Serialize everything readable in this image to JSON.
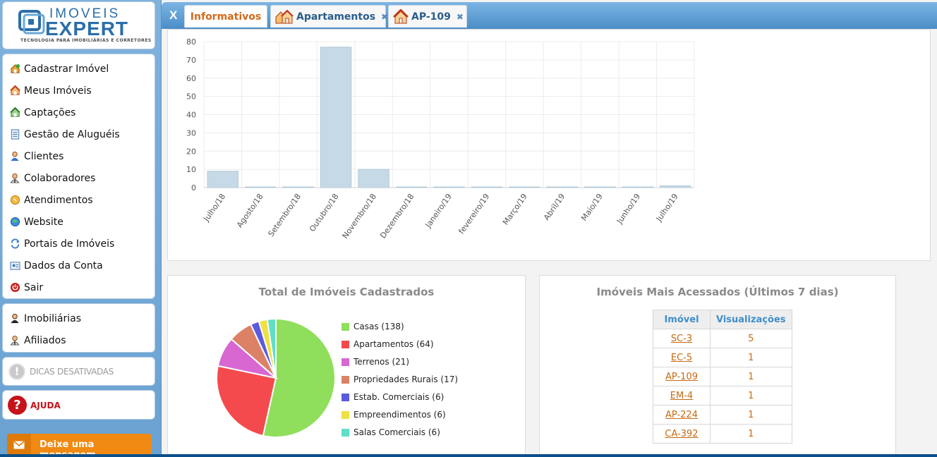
{
  "brand": {
    "title_line1": "IMOVEIS",
    "title_line2": "EXPERT",
    "tagline": "TECNOLOGIA PARA IMOBILIÁRIAS E CORRETORES"
  },
  "sidebar": {
    "menu": [
      {
        "label": "Cadastrar Imóvel",
        "icon": "house-add-icon"
      },
      {
        "label": "Meus Imóveis",
        "icon": "house-icon"
      },
      {
        "label": "Captações",
        "icon": "house-green-icon"
      },
      {
        "label": "Gestão de Aluguéis",
        "icon": "document-icon"
      },
      {
        "label": "Clientes",
        "icon": "user-icon"
      },
      {
        "label": "Colaboradores",
        "icon": "user-tie-icon"
      },
      {
        "label": "Atendimentos",
        "icon": "coin-icon"
      },
      {
        "label": "Website",
        "icon": "globe-icon"
      },
      {
        "label": "Portais de Imóveis",
        "icon": "refresh-icon"
      },
      {
        "label": "Dados da Conta",
        "icon": "account-icon"
      },
      {
        "label": "Sair",
        "icon": "power-icon"
      }
    ],
    "menu2": [
      {
        "label": "Imobiliárias",
        "icon": "user-dark-icon"
      },
      {
        "label": "Afiliados",
        "icon": "user-tie-icon"
      }
    ],
    "dicas_label": "DICAS DESATIVADAS",
    "ajuda_label": "AJUDA",
    "message_button": "Deixe uma mensagem"
  },
  "tabs": {
    "close_all": "X",
    "items": [
      {
        "label": "Informativos",
        "active": true
      },
      {
        "label": "Apartamentos",
        "active": false
      },
      {
        "label": "AP-109",
        "active": false
      }
    ]
  },
  "chart_data": [
    {
      "type": "bar",
      "categories": [
        "Julho/18",
        "Agosto/18",
        "Setembro/18",
        "Outubro/18",
        "Novembro/18",
        "Dezembro/18",
        "Janeiro/19",
        "fevereiro/19",
        "Março/19",
        "Abril/19",
        "Maio/19",
        "Junho/19",
        "Julho/19"
      ],
      "values": [
        9,
        0,
        0,
        77,
        10,
        0,
        0,
        0,
        0,
        0,
        0,
        0,
        1
      ],
      "ylim": [
        0,
        80
      ],
      "yticks": [
        0,
        10,
        20,
        30,
        40,
        50,
        60,
        70,
        80
      ],
      "grid": true,
      "bar_color": "#c6d9e6"
    },
    {
      "type": "pie",
      "title": "Total de Imóveis Cadastrados",
      "slices": [
        {
          "label": "Casas (138)",
          "value": 138,
          "color": "#8fdf5c"
        },
        {
          "label": "Apartamentos (64)",
          "value": 64,
          "color": "#f44a4d"
        },
        {
          "label": "Terrenos (21)",
          "value": 21,
          "color": "#d867d2"
        },
        {
          "label": "Propriedades Rurais (17)",
          "value": 17,
          "color": "#db8266"
        },
        {
          "label": "Estab. Comerciais (6)",
          "value": 6,
          "color": "#5b5bdf"
        },
        {
          "label": "Empreendimentos (6)",
          "value": 6,
          "color": "#efe046"
        },
        {
          "label": "Salas Comerciais (6)",
          "value": 6,
          "color": "#5ee0c6"
        }
      ],
      "legend": "right"
    }
  ],
  "most_accessed": {
    "title": "Imóveis Mais Acessados (Últimos 7 dias)",
    "col_property": "Imóvel",
    "col_views": "Visualizações",
    "rows": [
      {
        "code": "SC-3",
        "views": "5"
      },
      {
        "code": "EC-5",
        "views": "1"
      },
      {
        "code": "AP-109",
        "views": "1"
      },
      {
        "code": "EM-4",
        "views": "1"
      },
      {
        "code": "AP-224",
        "views": "1"
      },
      {
        "code": "CA-392",
        "views": "1"
      }
    ]
  }
}
